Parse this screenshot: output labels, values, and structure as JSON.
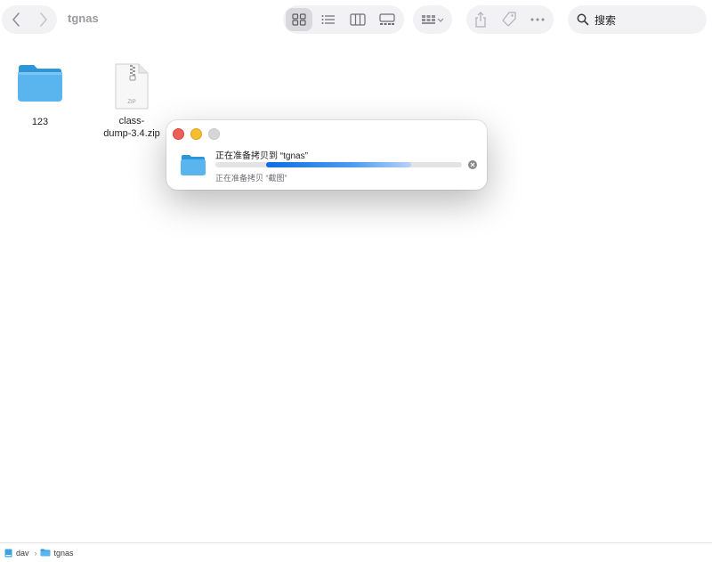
{
  "window": {
    "title": "tgnas"
  },
  "toolbar": {
    "nav": {
      "back_icon": "chevron-left-icon",
      "forward_icon": "chevron-right-icon"
    },
    "view_modes": [
      {
        "icon": "icon-view-grid-icon",
        "active": true
      },
      {
        "icon": "list-view-icon",
        "active": false
      },
      {
        "icon": "column-view-icon",
        "active": false
      },
      {
        "icon": "gallery-view-icon",
        "active": false
      }
    ],
    "group_icon": "group-menu-icon",
    "actions": [
      "share-icon",
      "tag-icon",
      "more-icon"
    ],
    "search": {
      "placeholder": "搜索"
    }
  },
  "files": [
    {
      "name": "123",
      "kind": "folder"
    },
    {
      "name": "class-dump-3.4.zip",
      "name_lines": [
        "class-",
        "dump-3.4.zip"
      ],
      "kind": "zip",
      "badge": "ZIP"
    }
  ],
  "copy_dialog": {
    "title": "正在准备拷贝到 “tgnas”",
    "subtitle": "正在准备拷贝 “截图”",
    "progress": 0.59,
    "accent": "#0a6fe0"
  },
  "path_bar": {
    "items": [
      {
        "label": "dav",
        "icon": "drive-icon"
      },
      {
        "label": "tgnas",
        "icon": "folder-icon"
      }
    ],
    "separator": "›"
  }
}
